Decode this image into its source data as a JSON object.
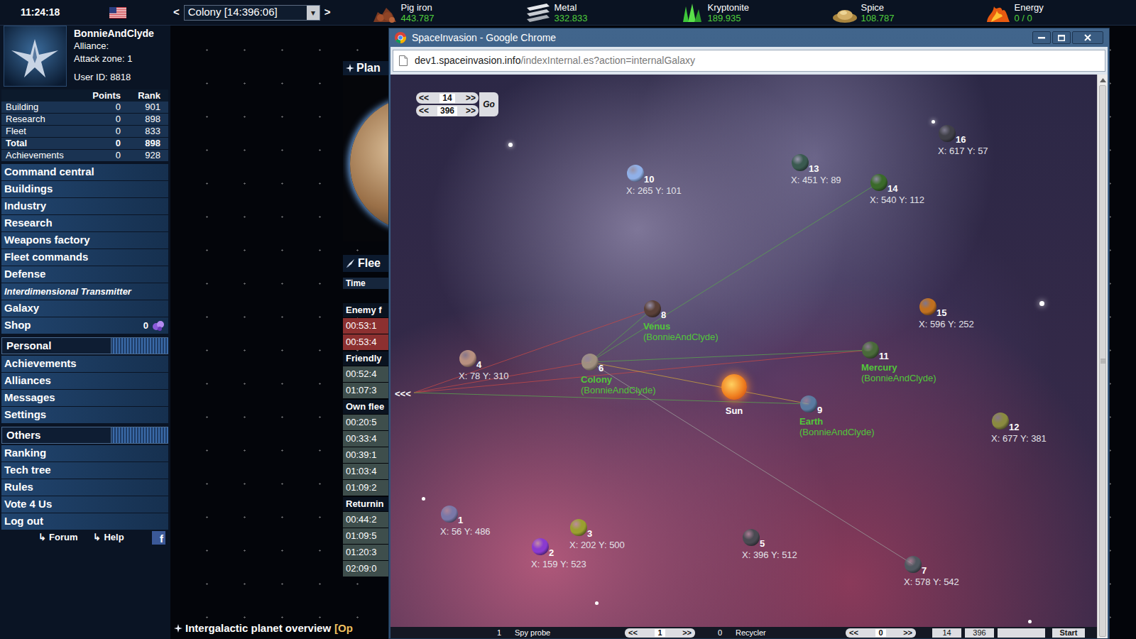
{
  "top_bar": {
    "time": "11:24:18",
    "planet_select": {
      "prev": "<",
      "value": "Colony [14:396:06]",
      "arrow": "▾",
      "next": ">"
    },
    "resources": [
      {
        "name": "Pig iron",
        "value": "443.787"
      },
      {
        "name": "Metal",
        "value": "332.833"
      },
      {
        "name": "Kryptonite",
        "value": "189.935"
      },
      {
        "name": "Spice",
        "value": "108.787"
      },
      {
        "name": "Energy",
        "value": "0 / 0"
      }
    ]
  },
  "player": {
    "name": "BonnieAndClyde",
    "alliance": "Alliance:",
    "attack_zone": "Attack zone: 1",
    "user_id": "User ID: 8818"
  },
  "stats": {
    "columns": [
      "Points",
      "Rank"
    ],
    "rows": [
      {
        "label": "Building",
        "points": "0",
        "rank": "901",
        "total": false
      },
      {
        "label": "Research",
        "points": "0",
        "rank": "898",
        "total": false
      },
      {
        "label": "Fleet",
        "points": "0",
        "rank": "833",
        "total": false
      },
      {
        "label": "Total",
        "points": "0",
        "rank": "898",
        "total": true
      },
      {
        "label": "Achievements",
        "points": "0",
        "rank": "928",
        "total": false
      }
    ]
  },
  "menu": [
    {
      "label": "Command central",
      "kind": "link"
    },
    {
      "label": "Buildings",
      "kind": "link"
    },
    {
      "label": "Industry",
      "kind": "link"
    },
    {
      "label": "Research",
      "kind": "link"
    },
    {
      "label": "Weapons factory",
      "kind": "link"
    },
    {
      "label": "Fleet commands",
      "kind": "link"
    },
    {
      "label": "Defense",
      "kind": "link"
    },
    {
      "label": "Interdimensional Transmitter",
      "kind": "special"
    },
    {
      "label": "Galaxy",
      "kind": "link"
    },
    {
      "label": "Shop",
      "kind": "shop",
      "badge": "0"
    },
    {
      "label": "Personal",
      "kind": "header"
    },
    {
      "label": "Achievements",
      "kind": "link"
    },
    {
      "label": "Alliances",
      "kind": "link"
    },
    {
      "label": "Messages",
      "kind": "link"
    },
    {
      "label": "Settings",
      "kind": "link"
    },
    {
      "label": "Others",
      "kind": "header"
    },
    {
      "label": "Ranking",
      "kind": "link"
    },
    {
      "label": "Tech tree",
      "kind": "link"
    },
    {
      "label": "Rules",
      "kind": "link"
    },
    {
      "label": "Vote 4 Us",
      "kind": "link"
    },
    {
      "label": "Log out",
      "kind": "link"
    }
  ],
  "footer": {
    "links": [
      {
        "arrow": "↳",
        "label": "Forum"
      },
      {
        "arrow": "↳",
        "label": "Help"
      }
    ],
    "facebook": "f"
  },
  "planet_panel": {
    "title": "Plan"
  },
  "fleet_panel": {
    "title": "Flee",
    "column": "Time",
    "groups": [
      {
        "label": "Enemy f",
        "kind": "enemy",
        "times": [
          "00:53:1",
          "00:53:4"
        ]
      },
      {
        "label": "Friendly",
        "kind": "friendly",
        "times": [
          "00:52:4",
          "01:07:3"
        ]
      },
      {
        "label": "Own flee",
        "kind": "own",
        "times": [
          "00:20:5",
          "00:33:4",
          "00:39:1",
          "01:03:4",
          "01:09:2"
        ]
      },
      {
        "label": "Returnin",
        "kind": "returning",
        "times": [
          "00:44:2",
          "01:09:5",
          "01:20:3",
          "02:09:0"
        ]
      }
    ]
  },
  "overview": {
    "title": "Intergalactic planet overview",
    "bracket": "[Op"
  },
  "browser": {
    "title": "SpaceInvasion - Google Chrome",
    "url_host": "dev1.spaceinvasion.info",
    "url_path": "/indexInternal.es?action=internalGalaxy"
  },
  "galaxy": {
    "nav": {
      "prev": "<<",
      "next": ">>",
      "galaxy": "14",
      "system": "396",
      "go": "Go"
    },
    "back": "<<<",
    "sun": "Sun",
    "planets": [
      {
        "number": "1",
        "coords": "X: 56 Y: 486",
        "color": "#7a78a8",
        "owned": false
      },
      {
        "number": "2",
        "coords": "X: 159 Y: 523",
        "color": "#8a3ad0",
        "owned": false
      },
      {
        "number": "3",
        "coords": "X: 202 Y: 500",
        "color": "#9aa030",
        "owned": false
      },
      {
        "number": "4",
        "coords": "X: 78 Y: 310",
        "color": "#b89080",
        "owned": false
      },
      {
        "number": "5",
        "coords": "X: 396 Y: 512",
        "color": "#4a4a52",
        "owned": false
      },
      {
        "number": "6",
        "name": "Colony",
        "owner": "(BonnieAndClyde)",
        "color": "#a09080",
        "owned": true
      },
      {
        "number": "7",
        "coords": "X: 578 Y: 542",
        "color": "#505860",
        "owned": false
      },
      {
        "number": "8",
        "name": "Venus",
        "owner": "(BonnieAndClyde)",
        "color": "#5a4038",
        "owned": true
      },
      {
        "number": "9",
        "name": "Earth",
        "owner": "(BonnieAndClyde)",
        "color": "#5a7aa0",
        "owned": true
      },
      {
        "number": "10",
        "coords": "X: 265 Y: 101",
        "color": "#90b0e8",
        "owned": false
      },
      {
        "number": "11",
        "name": "Mercury",
        "owner": "(BonnieAndClyde)",
        "color": "#4a6a3a",
        "owned": true
      },
      {
        "number": "12",
        "coords": "X: 677 Y: 381",
        "color": "#8a8a40",
        "owned": false
      },
      {
        "number": "13",
        "coords": "X: 451 Y: 89",
        "color": "#3a5a50",
        "owned": false
      },
      {
        "number": "14",
        "coords": "X: 540 Y: 112",
        "color": "#3a6a2a",
        "owned": false
      },
      {
        "number": "15",
        "coords": "X: 596 Y: 252",
        "color": "#c07020",
        "owned": false
      },
      {
        "number": "16",
        "coords": "X: 617 Y: 57",
        "color": "#404048",
        "owned": false
      }
    ],
    "routes": [
      {
        "from": "back",
        "to": "8",
        "color": "#c04848"
      },
      {
        "from": "back",
        "to": "6",
        "color": "#c04848"
      },
      {
        "from": "back",
        "to": "11",
        "color": "#c04848"
      },
      {
        "from": "back",
        "to": "9",
        "color": "#5aa050"
      },
      {
        "from": "6",
        "to": "14",
        "color": "#5aa050"
      },
      {
        "from": "6",
        "to": "8",
        "color": "#5aa050"
      },
      {
        "from": "6",
        "to": "11",
        "color": "#5aa050"
      },
      {
        "from": "6",
        "to": "9",
        "color": "#c8a040"
      },
      {
        "from": "6",
        "to": "7",
        "color": "#9a9a9a"
      }
    ],
    "ship_bar": {
      "ships": [
        {
          "count": "1",
          "name": "Spy probe",
          "amount": "1"
        },
        {
          "count": "0",
          "name": "Recycler",
          "amount": "0"
        }
      ],
      "target": [
        "14",
        "396"
      ],
      "start": "Start"
    }
  }
}
